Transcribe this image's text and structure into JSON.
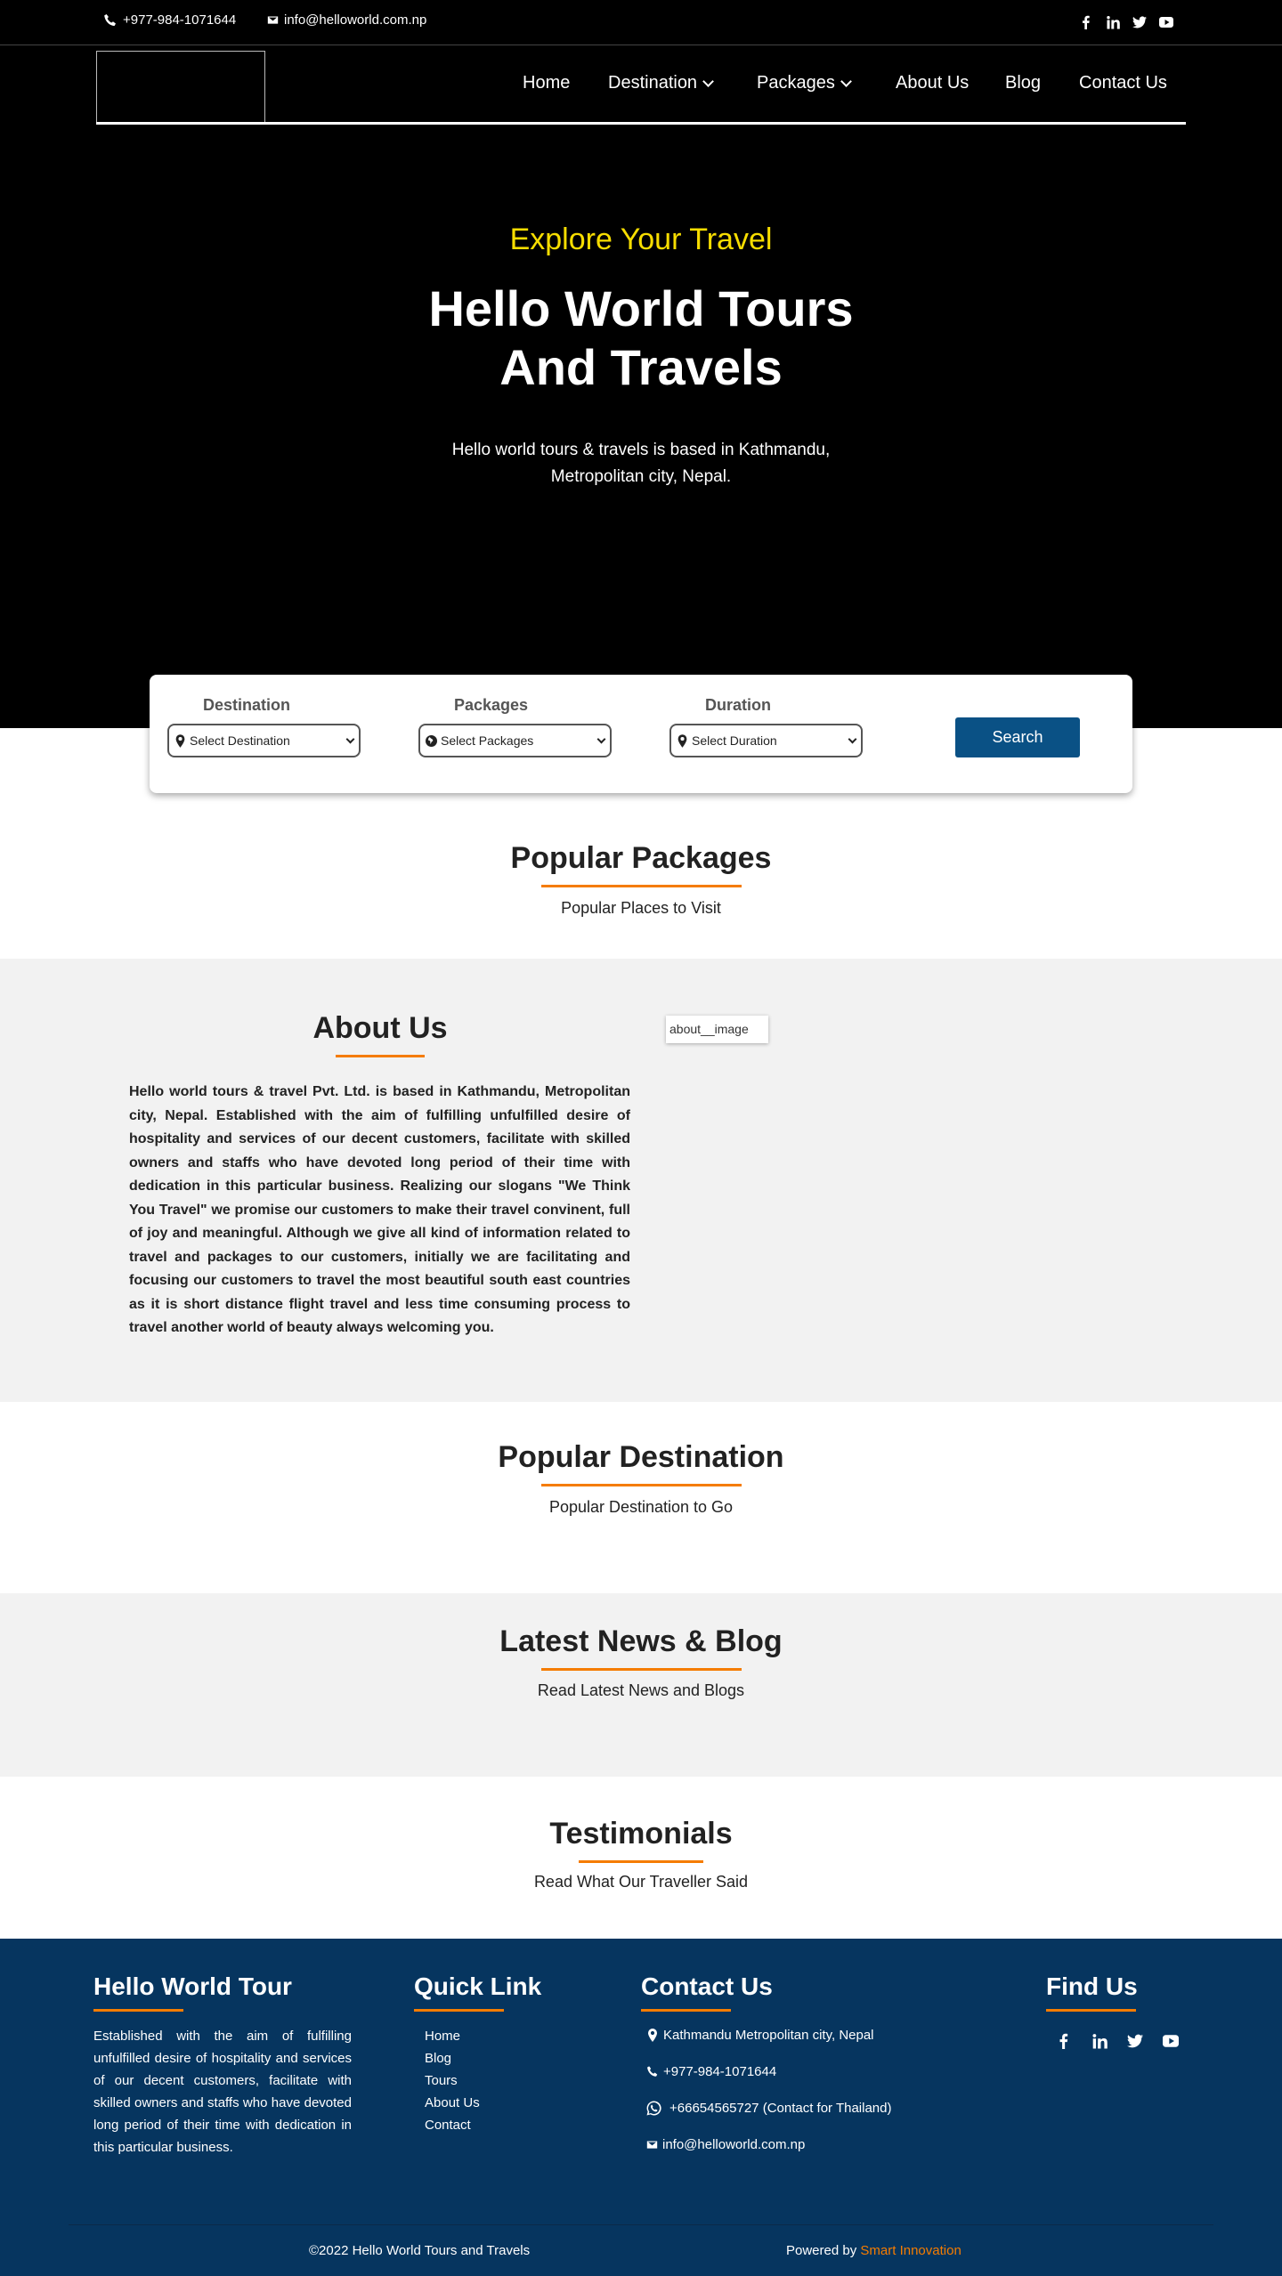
{
  "topbar": {
    "phone": "+977-984-1071644",
    "email": "info@helloworld.com.np",
    "social": [
      "facebook-icon",
      "linkedin-icon",
      "twitter-icon",
      "youtube-icon"
    ]
  },
  "nav": {
    "items": [
      {
        "label": "Home"
      },
      {
        "label": "Destination"
      },
      {
        "label": "Packages"
      },
      {
        "label": "About Us"
      },
      {
        "label": "Blog"
      },
      {
        "label": "Contact Us"
      }
    ]
  },
  "hero": {
    "subtitle": "Explore Your Travel",
    "title_line1": "Hello World Tours",
    "title_line2": "And Travels",
    "description": "Hello world tours & travels is based in Kathmandu, Metropolitan city, Nepal."
  },
  "search": {
    "destination_label": "Destination",
    "destination_value": "Select Destination",
    "packages_label": "Packages",
    "packages_value": "Select Packages",
    "duration_label": "Duration",
    "duration_value": "Select Duration",
    "button": "Search"
  },
  "popular_packages": {
    "title": "Popular Packages",
    "subtitle": "Popular Places to Visit"
  },
  "about": {
    "title": "About Us",
    "image_alt": "about__image",
    "text": "Hello world tours & travel Pvt. Ltd. is based in Kathmandu, Metropolitan city, Nepal. Established with the aim of fulfilling unfulfilled desire of hospitality and services of our decent customers, facilitate with skilled owners and staffs who have devoted long period of their time with dedication in this particular business. Realizing our slogans \"We Think You Travel\" we promise our customers to make their travel convinent, full of joy and meaningful. Although we give all kind of information related to travel and packages to our customers, initially we are facilitating and focusing our customers to travel the most beautiful south east countries as it is short distance flight travel and less time consuming process to travel another world of beauty always welcoming you."
  },
  "popular_destination": {
    "title": "Popular Destination",
    "subtitle": "Popular Destination to Go"
  },
  "blog": {
    "title": "Latest News & Blog",
    "subtitle": "Read Latest News and Blogs"
  },
  "testimonials": {
    "title": "Testimonials",
    "subtitle": "Read What Our Traveller Said"
  },
  "footer": {
    "about_title": "Hello World Tour",
    "about_text": "Established with the aim of fulfilling unfulfilled desire of hospitality and services of our decent customers, facilitate with skilled owners and staffs who have devoted long period of their time with dedication in this particular business.",
    "links_title": "Quick Link",
    "links": [
      "Home",
      "Blog",
      "Tours",
      "About Us",
      "Contact"
    ],
    "contact_title": "Contact Us",
    "address": "Kathmandu Metropolitan city, Nepal",
    "phone": "+977-984-1071644",
    "whatsapp": "+66654565727 (Contact for Thailand)",
    "email": "info@helloworld.com.np",
    "find_title": "Find Us",
    "copyright": "©2022 Hello World Tours and Travels",
    "powered_by": "Powered by",
    "powered_name": "Smart Innovation"
  },
  "colors": {
    "accent": "#f57c00",
    "button": "#0a5185",
    "footer": "#06355f",
    "hero_subtitle": "#f7dd00"
  }
}
